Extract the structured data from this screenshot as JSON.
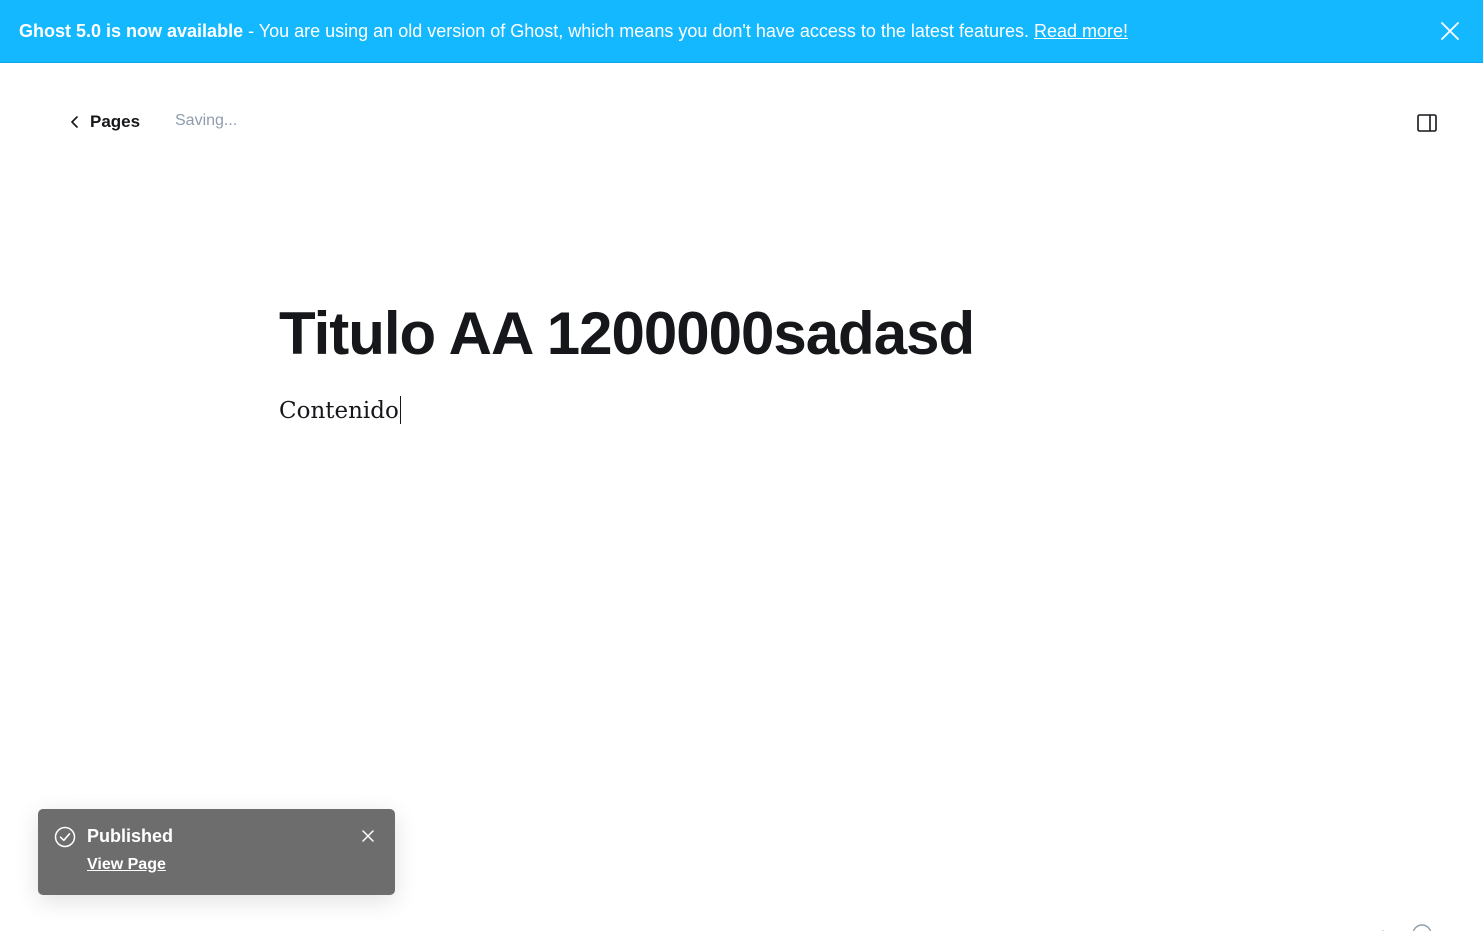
{
  "banner": {
    "strong_text": "Ghost 5.0 is now available",
    "message": "- You are using an old version of Ghost, which means you don't have access to the latest features.",
    "link_text": "Read more!",
    "close_icon": "close-icon",
    "background_color": "#14b8ff"
  },
  "header": {
    "back_label": "Pages",
    "back_icon": "chevron-left-icon",
    "save_status": "Saving...",
    "sidebar_toggle_icon": "sidebar-panel-icon"
  },
  "editor": {
    "title": "Titulo AA 1200000sadasd",
    "body": "Contenido"
  },
  "toast": {
    "icon": "check-circle-icon",
    "title": "Published",
    "link_text": "View Page",
    "close_icon": "close-icon",
    "background_color": "#6d6d6d"
  }
}
